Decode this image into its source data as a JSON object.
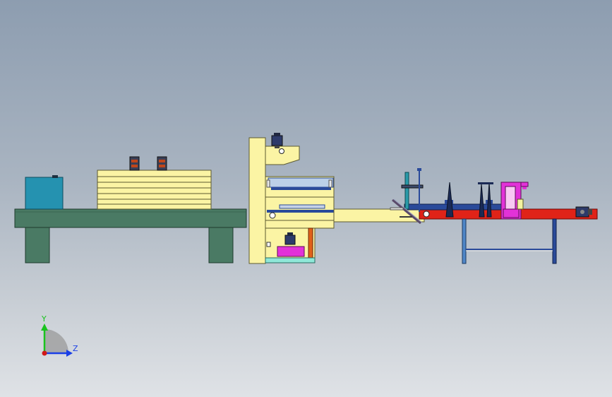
{
  "triad": {
    "y_label": "Y",
    "z_label": "Z",
    "y_color": "#19c31e",
    "z_color": "#1a3fe6",
    "origin_color": "#d01818"
  },
  "colors": {
    "background_top": "#8d9db0",
    "background_bottom": "#dfe2e6",
    "shrink_table": "#4a7a64",
    "heater_box": "#2592b0",
    "tunnel_body": "#fbf4a4",
    "frame_blue": "#2a4a9a",
    "infeed_conveyor": "#e02318",
    "magenta_block": "#e232d8",
    "motor": "#2d3a6a"
  }
}
